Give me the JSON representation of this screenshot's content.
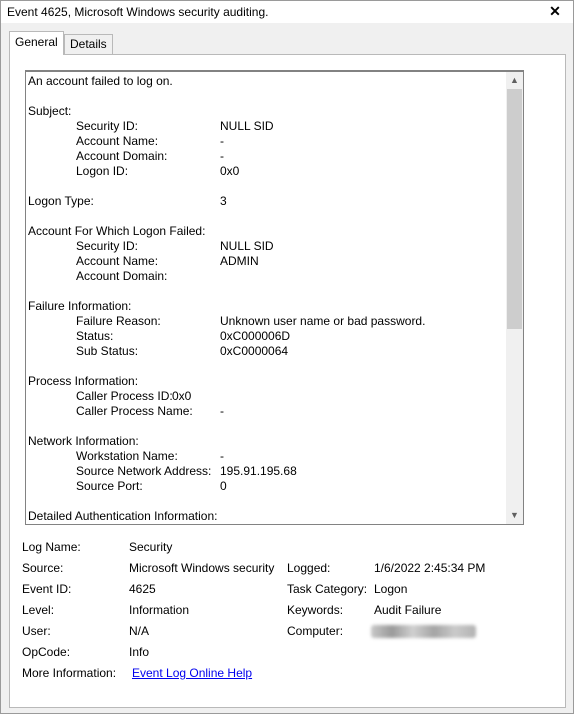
{
  "window": {
    "title": "Event 4625, Microsoft Windows security auditing.",
    "close_glyph": "✕"
  },
  "tabs": [
    {
      "label": "General",
      "active": true
    },
    {
      "label": "Details",
      "active": false
    }
  ],
  "message": {
    "lines": [
      {
        "label": "An account failed to log on.",
        "indent": false,
        "value": ""
      },
      {
        "label": "",
        "indent": false,
        "value": ""
      },
      {
        "label": "Subject:",
        "indent": false,
        "value": ""
      },
      {
        "label": "Security ID:",
        "indent": true,
        "value": "NULL SID"
      },
      {
        "label": "Account Name:",
        "indent": true,
        "value": "-"
      },
      {
        "label": "Account Domain:",
        "indent": true,
        "value": "-"
      },
      {
        "label": "Logon ID:",
        "indent": true,
        "value": "0x0"
      },
      {
        "label": "",
        "indent": false,
        "value": ""
      },
      {
        "label": "Logon Type:",
        "indent": false,
        "value": "3"
      },
      {
        "label": "",
        "indent": false,
        "value": ""
      },
      {
        "label": "Account For Which Logon Failed:",
        "indent": false,
        "value": ""
      },
      {
        "label": "Security ID:",
        "indent": true,
        "value": "NULL SID"
      },
      {
        "label": "Account Name:",
        "indent": true,
        "value": "ADMIN"
      },
      {
        "label": "Account Domain:",
        "indent": true,
        "value": ""
      },
      {
        "label": "",
        "indent": false,
        "value": ""
      },
      {
        "label": "Failure Information:",
        "indent": false,
        "value": ""
      },
      {
        "label": "Failure Reason:",
        "indent": true,
        "value": "Unknown user name or bad password."
      },
      {
        "label": "Status:",
        "indent": true,
        "value": "0xC000006D"
      },
      {
        "label": "Sub Status:",
        "indent": true,
        "value": "0xC0000064"
      },
      {
        "label": "",
        "indent": false,
        "value": ""
      },
      {
        "label": "Process Information:",
        "indent": false,
        "value": ""
      },
      {
        "label": "Caller Process ID:",
        "indent": true,
        "value": "0x0",
        "near": true
      },
      {
        "label": "Caller Process Name:",
        "indent": true,
        "value": "-"
      },
      {
        "label": "",
        "indent": false,
        "value": ""
      },
      {
        "label": "Network Information:",
        "indent": false,
        "value": ""
      },
      {
        "label": "Workstation Name:",
        "indent": true,
        "value": "-"
      },
      {
        "label": "Source Network Address:",
        "indent": true,
        "value": "195.91.195.68"
      },
      {
        "label": "Source Port:",
        "indent": true,
        "value": "0"
      },
      {
        "label": "",
        "indent": false,
        "value": ""
      },
      {
        "label": "Detailed Authentication Information:",
        "indent": false,
        "value": ""
      }
    ],
    "scroll_up_glyph": "▲",
    "scroll_down_glyph": "▼"
  },
  "properties": {
    "log_name": {
      "label": "Log Name:",
      "value": "Security"
    },
    "source": {
      "label": "Source:",
      "value": "Microsoft Windows security"
    },
    "logged": {
      "label": "Logged:",
      "value": "1/6/2022 2:45:34 PM"
    },
    "event_id": {
      "label": "Event ID:",
      "value": "4625"
    },
    "task_category": {
      "label": "Task Category:",
      "value": "Logon"
    },
    "level": {
      "label": "Level:",
      "value": "Information"
    },
    "keywords": {
      "label": "Keywords:",
      "value": "Audit Failure"
    },
    "user": {
      "label": "User:",
      "value": "N/A"
    },
    "computer": {
      "label": "Computer:",
      "value": ""
    },
    "opcode": {
      "label": "OpCode:",
      "value": "Info"
    },
    "more_info": {
      "label": "More Information:",
      "link": "Event Log Online Help"
    }
  }
}
